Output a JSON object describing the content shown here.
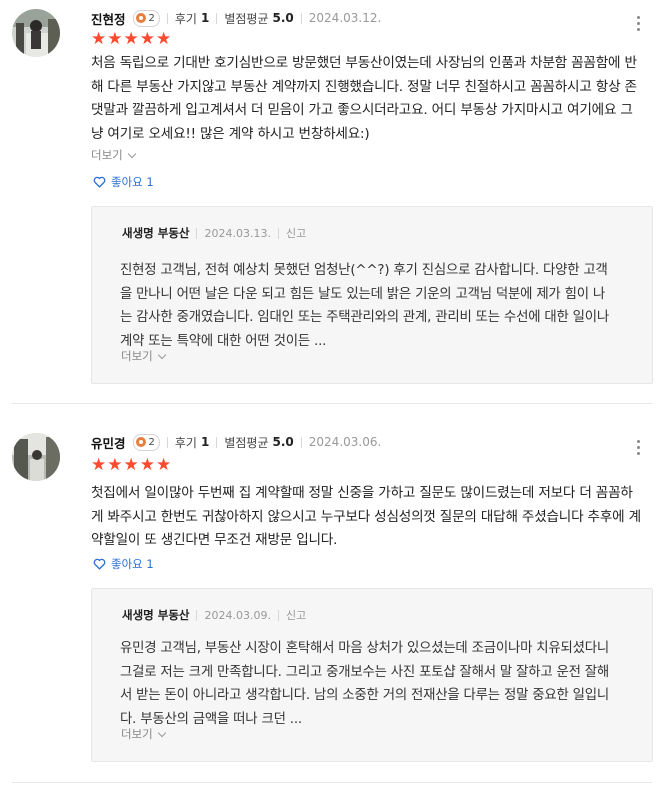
{
  "reviews": [
    {
      "author": "진현정",
      "level": "2",
      "review_label": "후기",
      "review_count": "1",
      "rating_label": "별점평균",
      "rating_avg": "5.0",
      "date": "2024.03.12.",
      "stars": 5,
      "text": "처음 독립으로 기대반 호기심반으로 방문했던 부동산이였는데 사장님의 인품과 차분함 꼼꼼함에 반해 다른 부동산 가지않고 부동산 계약까지 진행했습니다. 정말 너무 친절하시고 꼼꼼하시고 항상 존댓말과 깔끔하게 입고계셔서 더 믿음이 가고 좋으시더라고요. 어디 부동상 가지마시고 여기에요 그냥 여기로 오세요!! 많은 계약 하시고 번창하세요:)",
      "more": "더보기",
      "like_label": "좋아요 1",
      "reply": {
        "name": "새생명 부동산",
        "date": "2024.03.13.",
        "report": "신고",
        "text": "진현정 고객님, 전혀 예상치 못했던 엄청난(^^?) 후기 진심으로 감사합니다. 다양한 고객을 만나니 어떤 날은 다운 되고 힘든 날도 있는데 밝은 기운의 고객님 덕분에 제가 힘이 나는 감사한 중개였습니다. 임대인 또는 주택관리와의 관계, 관리비 또는 수선에 대한 일이나 계약 또는 특약에 대한 어떤 것이든 ...",
        "more": "더보기"
      }
    },
    {
      "author": "유민경",
      "level": "2",
      "review_label": "후기",
      "review_count": "1",
      "rating_label": "별점평균",
      "rating_avg": "5.0",
      "date": "2024.03.06.",
      "stars": 5,
      "text": "첫집에서 일이많아 두번째 집 계약할때 정말 신중을 가하고 질문도 많이드렸는데 저보다 더 꼼꼼하게 봐주시고 한번도 귀찮아하지 않으시고 누구보다 성심성의껏 질문의 대답해 주셨습니다 추후에 계약할일이 또 생긴다면 무조건 재방문 입니다.",
      "more": "",
      "like_label": "좋아요 1",
      "reply": {
        "name": "새생명 부동산",
        "date": "2024.03.09.",
        "report": "신고",
        "text": "유민경 고객님, 부동산 시장이 혼탁해서 마음 상처가 있으셨는데 조금이나마 치유되셨다니 그걸로 저는 크게 만족합니다. 그리고 중개보수는 사진 포토샵 잘해서 말 잘하고 운전 잘해서 받는 돈이 아니라고 생각합니다. 남의 소중한 거의 전재산을 다루는 정말 중요한 일입니다. 부동산의 금액을 떠나 크던 ...",
        "more": "더보기"
      }
    }
  ],
  "colors": {
    "star": "#fa4a2f",
    "like": "#2b6fd6",
    "reply_bg": "#f6f6f7"
  },
  "icons": [
    "more-vertical-icon",
    "heart-icon",
    "chevron-down-icon",
    "level-badge-icon",
    "star-icon"
  ]
}
